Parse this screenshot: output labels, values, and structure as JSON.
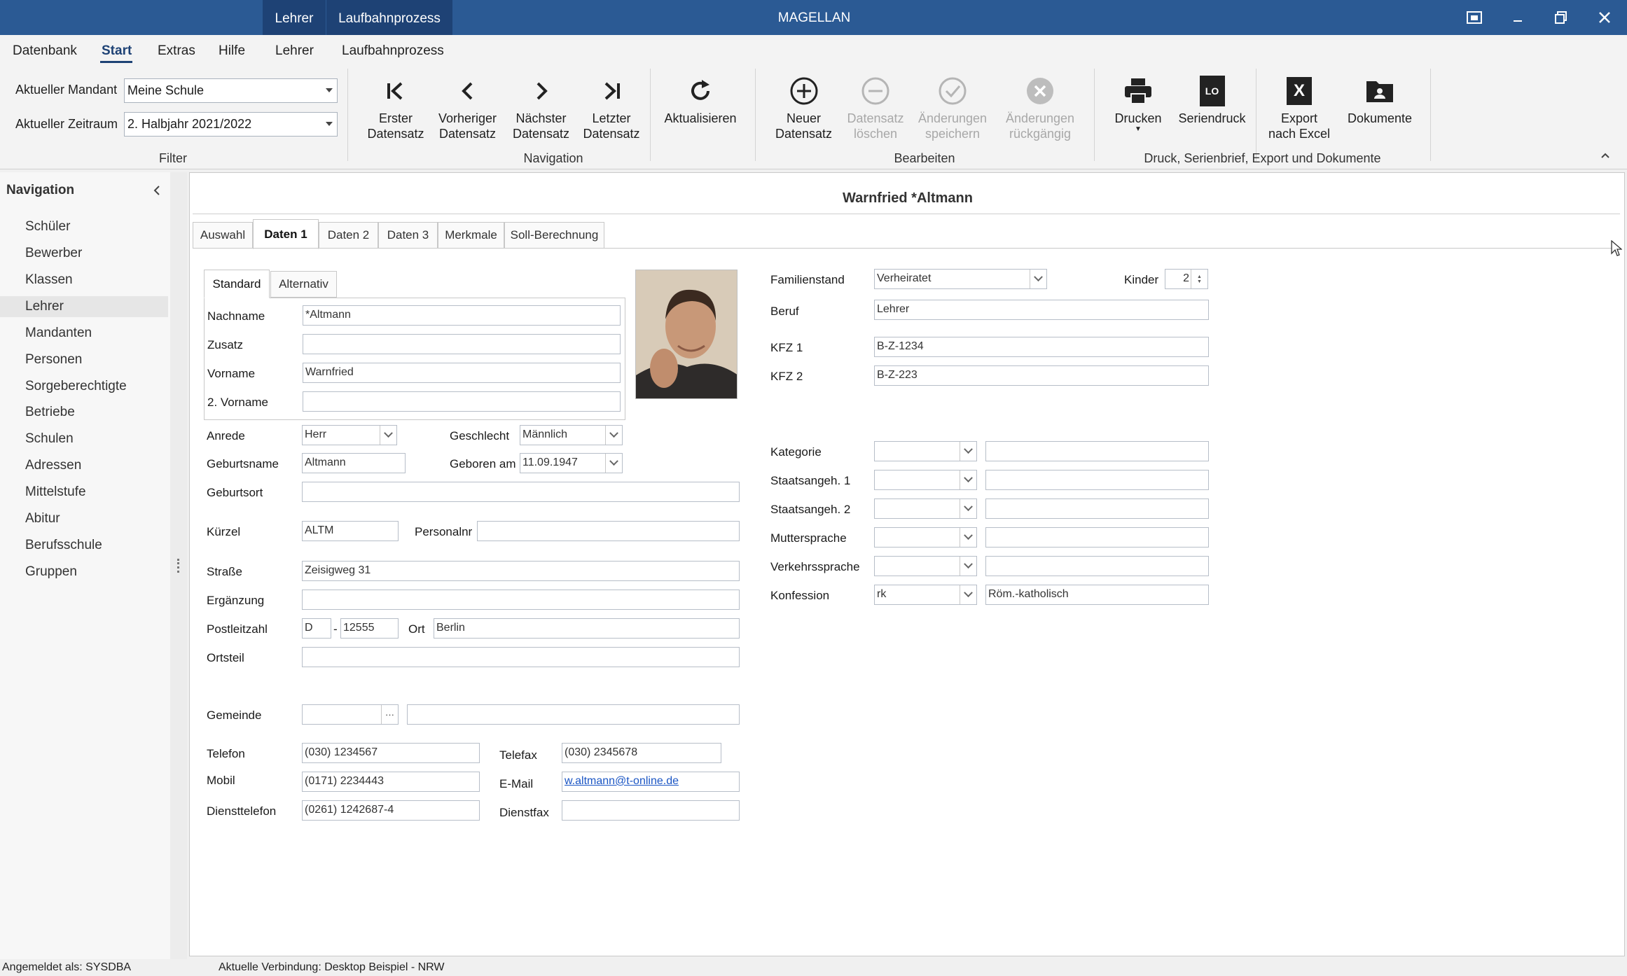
{
  "app": {
    "title": "MAGELLAN"
  },
  "context_tabs": [
    "Lehrer",
    "Laufbahnprozess"
  ],
  "menu": [
    "Datenbank",
    "Start",
    "Extras",
    "Hilfe",
    "Lehrer",
    "Laufbahnprozess"
  ],
  "filter": {
    "mandant_label": "Aktueller Mandant",
    "mandant_value": "Meine Schule",
    "zeitraum_label": "Aktueller Zeitraum",
    "zeitraum_value": "2. Halbjahr 2021/2022",
    "group_label": "Filter"
  },
  "ribbon": {
    "nav_group": "Navigation",
    "edit_group": "Bearbeiten",
    "print_group": "Druck, Serienbrief, Export und Dokumente",
    "btn_first": [
      "Erster",
      "Datensatz"
    ],
    "btn_prev": [
      "Vorheriger",
      "Datensatz"
    ],
    "btn_next": [
      "Nächster",
      "Datensatz"
    ],
    "btn_last": [
      "Letzter",
      "Datensatz"
    ],
    "btn_refresh": [
      "Aktualisieren",
      ""
    ],
    "btn_new": [
      "Neuer",
      "Datensatz"
    ],
    "btn_delete": [
      "Datensatz",
      "löschen"
    ],
    "btn_save": [
      "Änderungen",
      "speichern"
    ],
    "btn_undo": [
      "Änderungen",
      "rückgängig"
    ],
    "btn_print": [
      "Drucken",
      ""
    ],
    "btn_serial": [
      "Seriendruck",
      ""
    ],
    "btn_excel": [
      "Export",
      "nach Excel"
    ],
    "btn_docs": [
      "Dokumente",
      ""
    ],
    "serial_icon_text": "LO",
    "excel_icon_text": "X"
  },
  "navigation": {
    "title": "Navigation",
    "items": [
      "Schüler",
      "Bewerber",
      "Klassen",
      "Lehrer",
      "Mandanten",
      "Personen",
      "Sorgeberechtigte",
      "Betriebe",
      "Schulen",
      "Adressen",
      "Mittelstufe",
      "Abitur",
      "Berufsschule",
      "Gruppen"
    ],
    "selected": "Lehrer"
  },
  "record": {
    "title": "Warnfried *Altmann"
  },
  "tabs": [
    "Auswahl",
    "Daten 1",
    "Daten 2",
    "Daten 3",
    "Merkmale",
    "Soll-Berechnung"
  ],
  "subtabs": [
    "Standard",
    "Alternativ"
  ],
  "form": {
    "nachname_label": "Nachname",
    "nachname": "*Altmann",
    "zusatz_label": "Zusatz",
    "zusatz": "",
    "vorname_label": "Vorname",
    "vorname": "Warnfried",
    "vorname2_label": "2. Vorname",
    "vorname2": "",
    "anrede_label": "Anrede",
    "anrede": "Herr",
    "geschlecht_label": "Geschlecht",
    "geschlecht": "Männlich",
    "geburtsname_label": "Geburtsname",
    "geburtsname": "Altmann",
    "geboren_label": "Geboren am",
    "geboren": "11.09.1947",
    "geburtsort_label": "Geburtsort",
    "geburtsort": "",
    "kuerzel_label": "Kürzel",
    "kuerzel": "ALTM",
    "personalnr_label": "Personalnr",
    "personalnr": "",
    "strasse_label": "Straße",
    "strasse": "Zeisigweg 31",
    "ergaenzung_label": "Ergänzung",
    "ergaenzung": "",
    "plz_label": "Postleitzahl",
    "land": "D",
    "plz_sep": "-",
    "plz": "12555",
    "ort_label": "Ort",
    "ort": "Berlin",
    "ortsteil_label": "Ortsteil",
    "ortsteil": "",
    "gemeinde_label": "Gemeinde",
    "gemeinde": "",
    "gemeinde_name": "",
    "gemeinde_btn": "···",
    "telefon_label": "Telefon",
    "telefon": "(030) 1234567",
    "telefax_label": "Telefax",
    "telefax": "(030) 2345678",
    "mobil_label": "Mobil",
    "mobil": "(0171) 2234443",
    "email_label": "E-Mail",
    "email": "w.altmann@t-online.de",
    "diensttelefon_label": "Diensttelefon",
    "diensttelefon": "(0261) 1242687-4",
    "dienstfax_label": "Dienstfax",
    "dienstfax": "",
    "familienstand_label": "Familienstand",
    "familienstand": "Verheiratet",
    "kinder_label": "Kinder",
    "kinder": "2",
    "beruf_label": "Beruf",
    "beruf": "Lehrer",
    "kfz1_label": "KFZ 1",
    "kfz1": "B-Z-1234",
    "kfz2_label": "KFZ 2",
    "kfz2": "B-Z-223",
    "kategorie_label": "Kategorie",
    "staatsangeh1_label": "Staatsangeh. 1",
    "staatsangeh2_label": "Staatsangeh. 2",
    "muttersprache_label": "Muttersprache",
    "verkehrssprache_label": "Verkehrssprache",
    "konfession_label": "Konfession",
    "konfession": "rk",
    "konfession_text": "Röm.-katholisch"
  },
  "status": {
    "user": "Angemeldet als: SYSDBA",
    "connection": "Aktuelle Verbindung: Desktop Beispiel - NRW"
  },
  "colors": {
    "titlebar": "#2b5a94",
    "accent": "#1e4275"
  }
}
